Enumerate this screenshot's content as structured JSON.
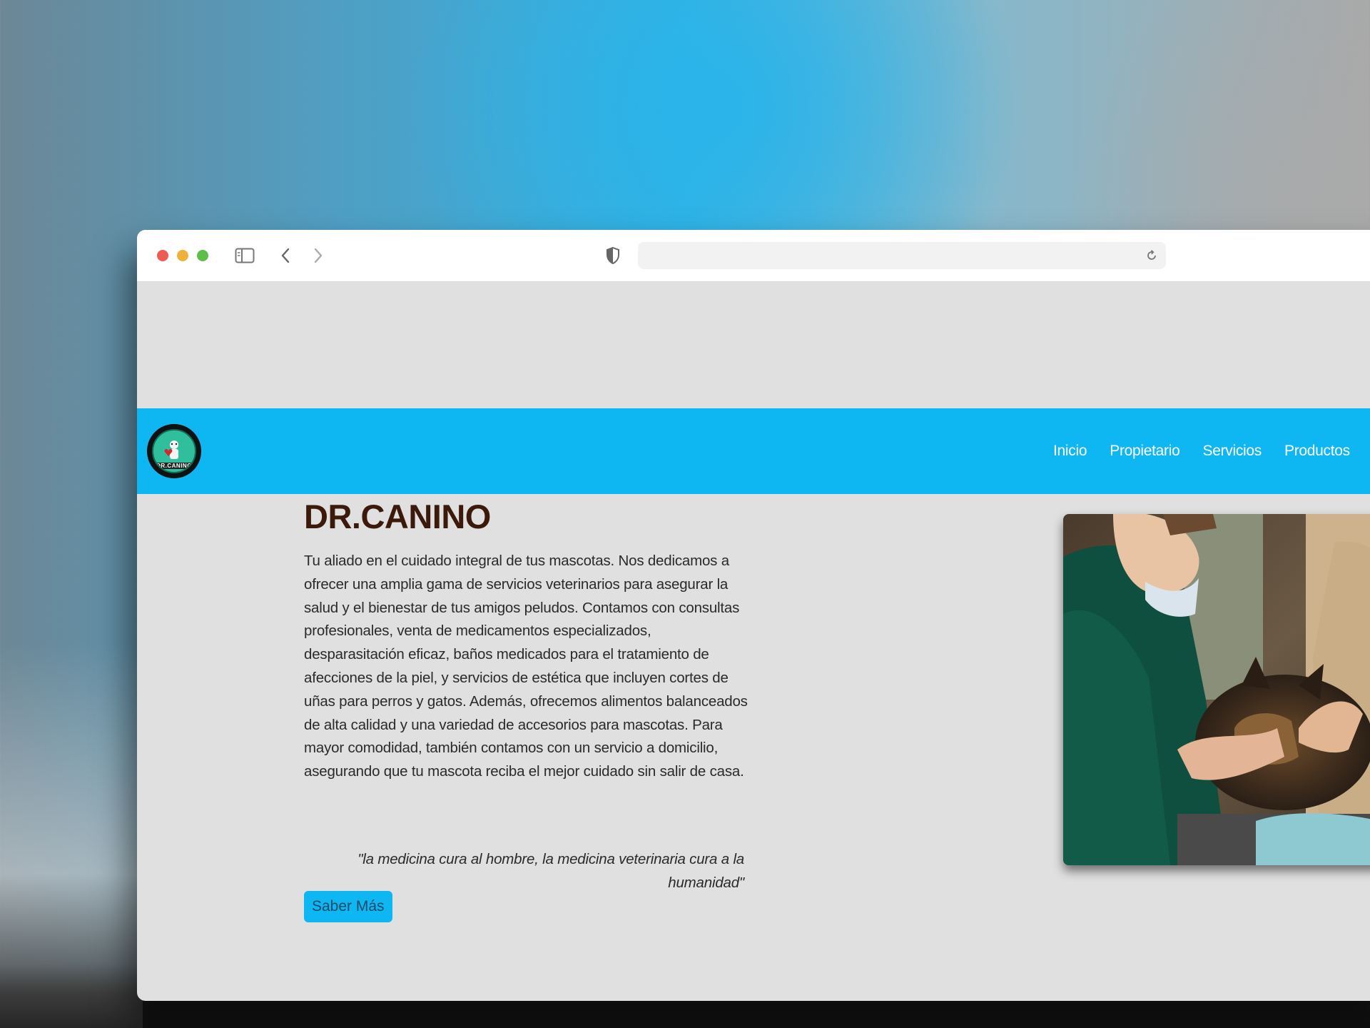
{
  "browser": {
    "url": ""
  },
  "site": {
    "logo_text": "DR.CANINO",
    "nav": [
      "Inicio",
      "Propietario",
      "Servicios",
      "Productos"
    ]
  },
  "hero": {
    "title": "DR.CANINO",
    "text": "Tu aliado en el cuidado integral de tus mascotas. Nos dedicamos a ofrecer una amplia gama de servicios veterinarios para asegurar la salud y el bienestar de tus amigos peludos. Contamos con consultas profesionales, venta de medicamentos especializados, desparasitación eficaz, baños medicados para el tratamiento de afecciones de la piel, y servicios de estética que incluyen cortes de uñas para perros y gatos. Además, ofrecemos alimentos balanceados de alta calidad y una variedad de accesorios para mascotas. Para mayor comodidad, también contamos con un servicio a domicilio, asegurando que tu mascota reciba el mejor cuidado sin salir de casa.",
    "quote": "\"la medicina cura al hombre, la medicina veterinaria cura a la humanidad\"",
    "button": "Saber Más"
  },
  "colors": {
    "navbar": "#0eb6f2",
    "title": "#3c1a0b",
    "page_bg": "#e0e0e0"
  }
}
